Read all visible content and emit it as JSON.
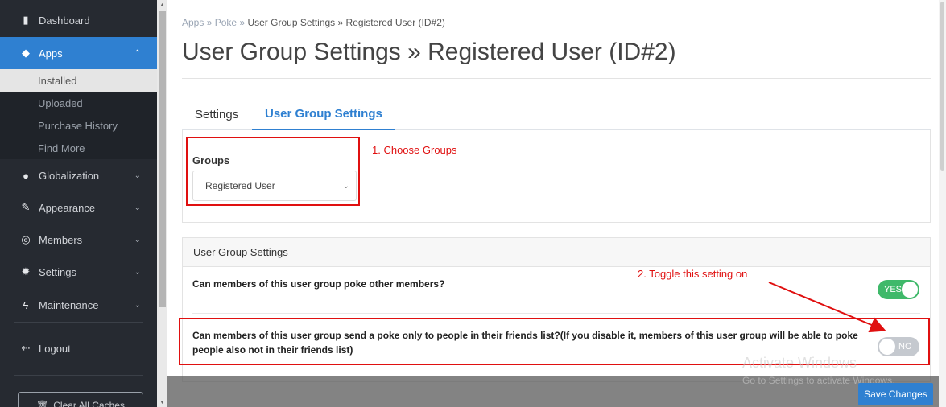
{
  "sidebar": {
    "items": [
      {
        "label": "Dashboard",
        "icon": "bar-chart-icon"
      },
      {
        "label": "Apps",
        "icon": "cube-icon"
      },
      {
        "label": "Globalization",
        "icon": "globe-icon"
      },
      {
        "label": "Appearance",
        "icon": "brush-icon"
      },
      {
        "label": "Members",
        "icon": "user-circle-icon"
      },
      {
        "label": "Settings",
        "icon": "gear-icon"
      },
      {
        "label": "Maintenance",
        "icon": "bolt-icon"
      },
      {
        "label": "Logout",
        "icon": "logout-icon"
      }
    ],
    "apps_sub": [
      "Installed",
      "Uploaded",
      "Purchase History",
      "Find More"
    ],
    "clear_cache": "Clear All Caches"
  },
  "breadcrumb": {
    "apps": "Apps",
    "sep": "»",
    "poke": "Poke",
    "current": "User Group Settings » Registered User (ID#2)"
  },
  "page_title": "User Group Settings » Registered User (ID#2)",
  "tabs": [
    "Settings",
    "User Group Settings"
  ],
  "groups": {
    "label": "Groups",
    "selected": "Registered User"
  },
  "annotations": {
    "step1": "1. Choose Groups",
    "step2": "2. Toggle this setting on"
  },
  "settings_panel": {
    "header": "User Group Settings",
    "q1": "Can members of this user group poke other members?",
    "q1_toggle": "YES",
    "q2": "Can members of this user group send a poke only to people in their friends list?(If you disable it, members of this user group will be able to poke people also not in their friends list)",
    "q2_toggle": "NO"
  },
  "save_button": "Save Changes",
  "watermark": {
    "line1": "Activate Windows",
    "line2": "Go to Settings to activate Windows."
  },
  "colors": {
    "accent": "#2f80d1",
    "sidebar": "#262a31",
    "annotation": "#e01010",
    "toggle_on": "#3fb96a"
  }
}
